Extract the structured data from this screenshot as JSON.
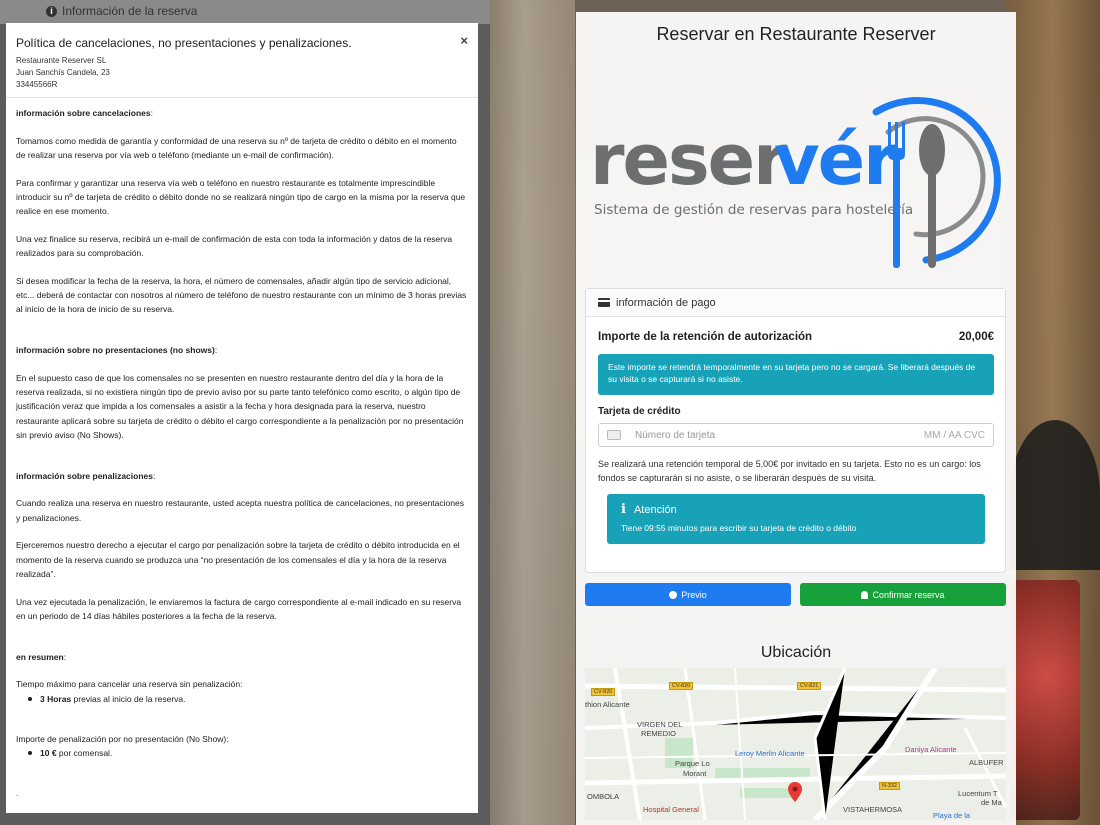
{
  "background": {
    "strip_label": "Información de la reserva",
    "page_title": "Reservar en Restaurante Reserver",
    "logo": {
      "wordmark": "reservér",
      "tagline": "Sistema de gestión de reservas para hostelería"
    },
    "payment": {
      "header": "información de pago",
      "amount_label": "Importe de la retención de autorización",
      "amount_value": "20,00€",
      "alert": "Este importe se retendrá temporalmente en su tarjeta pero no se cargará. Se liberará después de su visita o se capturará si no asiste.",
      "card_label": "Tarjeta de crédito",
      "card_placeholder": "Número de tarjeta",
      "card_exp_cvc": "MM / AA  CVC",
      "note": "Se realizará una retención temporal de 5,00€ por invitado en su tarjeta. Esto no es un cargo: los fondos se capturarán si no asiste, o se liberarán después de su visita.",
      "attention_title": "Atención",
      "attention_body": "Tiene 09:55 minutos para escribir su tarjeta de crédito o débito"
    },
    "buttons": {
      "prev": "Previo",
      "confirm": "Confirmar reserva"
    },
    "location_title": "Ubicación",
    "map": {
      "labels": [
        "thion Alicante",
        "VIRGEN DEL",
        "REMEDIO",
        "Parque Lo",
        "Morant",
        "Leroy Merlin Alicante",
        "Daniya Alicante",
        "ALBUFER",
        "Lucentum T",
        "de Ma",
        "OMBOLA",
        "Hospital General",
        "VISTAHERMOSA",
        "Playa de la"
      ],
      "badges": [
        "CV-820",
        "CV-820",
        "CV-821",
        "N-332"
      ]
    },
    "colors": {
      "accent_blue": "#1e7cf0",
      "info_teal": "#17a2b8",
      "confirm_green": "#17a13a"
    }
  },
  "modal": {
    "title": "Política de cancelaciones, no presentaciones y penalizaciones.",
    "company": "Restaurante Reserver SL",
    "address": "Juan Sanchís Candela, 23",
    "tax_id": "33445566R",
    "close": "×",
    "sections": {
      "cancel_heading": "información sobre cancelaciones",
      "cancel_p1": "Tomamos como medida de garantía y conformidad de una reserva su nº de tarjeta de crédito o débito en el momento de realizar una reserva por vía web o teléfono (mediante un e-mail de confirmación).",
      "cancel_p2": "Para confirmar y garantizar una reserva vía web o teléfono en nuestro restaurante es totalmente imprescindible introducir su nº de tarjeta de crédito o débito donde no se realizará ningún tipo de cargo en la misma por la reserva que realice en ese momento.",
      "cancel_p3": "Una vez finalice su reserva, recibirá un e-mail de confirmación de esta con toda la información y datos de la reserva realizados para su comprobación.",
      "cancel_p4": "Si desea modificar la fecha de la reserva, la hora, el número de comensales, añadir algún tipo de servicio adicional, etc... deberá de contactar con nosotros al número de teléfono de nuestro restaurante con un mínimo de 3 horas previas al inicio de la hora de inicio de su reserva.",
      "noshow_heading": "información sobre no presentaciones (no shows)",
      "noshow_p1": "En el supuesto caso de que los comensales no se presenten en nuestro restaurante dentro del día y la hora de la reserva realizada, si no existiera ningún tipo de previo aviso por su parte tanto telefónico como escrito, o algún tipo de justificación veraz que impida a los comensales a asistir a la fecha y hora designada para la reserva, nuestro restaurante aplicará sobre su tarjeta de crédito o débito el cargo correspondiente a la penalización por no presentación sin previo aviso (No Shows).",
      "penalty_heading": "información sobre penalizaciones",
      "penalty_p1": "Cuando realiza una reserva en nuestro restaurante, usted acepta nuestra política de cancelaciones, no presentaciones y penalizaciones.",
      "penalty_p2": "Ejerceremos nuestro derecho a ejecutar el cargo por penalización sobre la tarjeta de crédito o débito introducida en el momento de la reserva cuando se produzca una “no presentación de los comensales el día y la hora de la reserva realizada”.",
      "penalty_p3": "Una vez ejecutada la penalización, le enviaremos la factura de cargo correspondiente al e-mail indicado en su reserva en un periodo de 14 días hábiles posteriores a la fecha de la reserva.",
      "summary_heading": "en resumen",
      "summary_cancel_label": "Tiempo máximo para cancelar una reserva sin penalización:",
      "summary_cancel_bold": "3 Horas",
      "summary_cancel_rest": " previas al inicio de la reserva.",
      "summary_fee_label": "Importe de penalización por no presentación (No Show):",
      "summary_fee_bold": "10 €",
      "summary_fee_rest": " por comensal.",
      "trailing": "."
    }
  }
}
